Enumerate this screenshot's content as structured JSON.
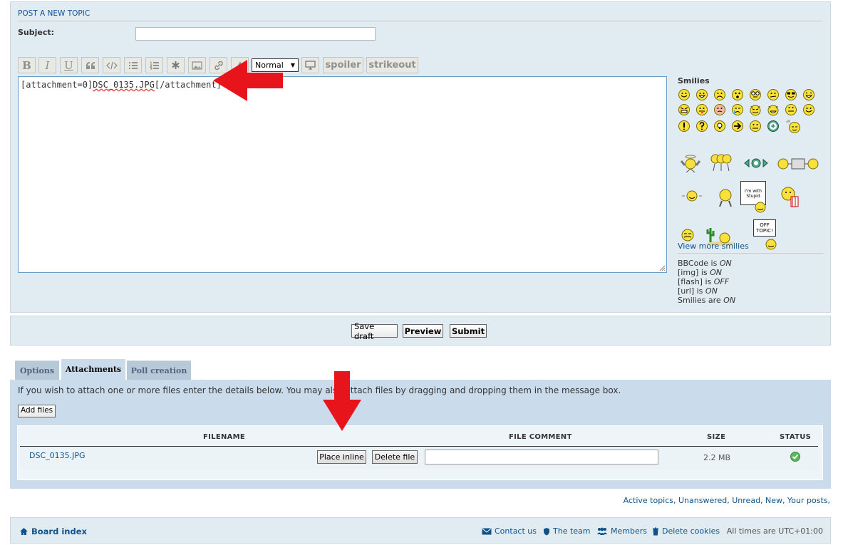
{
  "post": {
    "title": "POST A NEW TOPIC",
    "subject_label": "Subject:",
    "subject_value": ""
  },
  "toolbar": {
    "bold": "B",
    "italic": "I",
    "underline": "U",
    "font_size": "Normal",
    "spoiler": "spoiler",
    "strikeout": "strikeout"
  },
  "message": {
    "prefix": "[attachment=0]",
    "filename": "DSC_0135.JPG",
    "suffix": "[/attachment]"
  },
  "smilies": {
    "title": "Smilies",
    "view_more": "View more smilies",
    "bbcode": "BBCode is ",
    "bbcode_state": "ON",
    "img": "[img] is ",
    "img_state": "ON",
    "flash": "[flash] is ",
    "flash_state": "OFF",
    "url": "[url] is ",
    "url_state": "ON",
    "smilies_line": "Smilies are ",
    "smilies_state": "ON",
    "sign_text_1": "I'm with Stupid",
    "sign_text_2": "OFF TOPIC!"
  },
  "actions": {
    "save_draft": "Save draft",
    "preview": "Preview",
    "submit": "Submit"
  },
  "tabs": [
    "Options",
    "Attachments",
    "Poll creation"
  ],
  "attachments": {
    "info": "If you wish to attach one or more files enter the details below. You may also attach files by dragging and dropping them in the message box.",
    "add_files": "Add files",
    "headers": {
      "filename": "FILENAME",
      "comment": "FILE COMMENT",
      "size": "SIZE",
      "status": "STATUS"
    },
    "file": {
      "name": "DSC_0135.JPG",
      "place_inline": "Place inline",
      "delete": "Delete file",
      "comment": "",
      "size": "2.2 MB"
    }
  },
  "footer": {
    "links": "Active topics, Unanswered, Unread, New, Your posts,",
    "board_index": "Board index",
    "contact": "Contact us",
    "team": "The team",
    "members": "Members",
    "delete_cookies": "Delete cookies",
    "timezone": "All times are UTC+01:00"
  },
  "colors": {
    "panel_bg": "#e1ebf2",
    "tab_active": "#cadceb",
    "link": "#105289",
    "arrow": "#e8141b"
  }
}
